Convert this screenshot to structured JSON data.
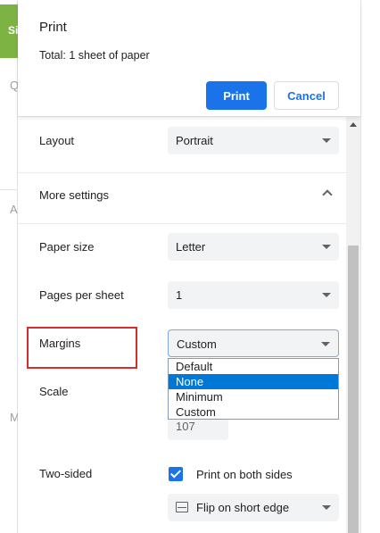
{
  "background": {
    "green_tab_text": "Si",
    "letters": [
      "Q",
      "A",
      "M"
    ]
  },
  "dialog": {
    "title": "Print",
    "total": "Total: 1 sheet of paper",
    "print_button": "Print",
    "cancel_button": "Cancel"
  },
  "settings": {
    "layout": {
      "label": "Layout",
      "value": "Portrait"
    },
    "more_settings": {
      "label": "More settings",
      "expanded": true
    },
    "paper_size": {
      "label": "Paper size",
      "value": "Letter"
    },
    "pages_per_sheet": {
      "label": "Pages per sheet",
      "value": "1"
    },
    "margins": {
      "label": "Margins",
      "value": "Custom",
      "options": [
        "Default",
        "None",
        "Minimum",
        "Custom"
      ],
      "highlighted_option": "None"
    },
    "scale": {
      "label": "Scale",
      "value": "107"
    },
    "two_sided": {
      "label": "Two-sided",
      "checkbox_label": "Print on both sides",
      "checked": true,
      "flip_value": "Flip on short edge"
    }
  },
  "colors": {
    "accent": "#1a73e8",
    "highlight_box": "#d32f2f",
    "selected_option": "#0078d7",
    "green_tab": "#7cb342"
  }
}
